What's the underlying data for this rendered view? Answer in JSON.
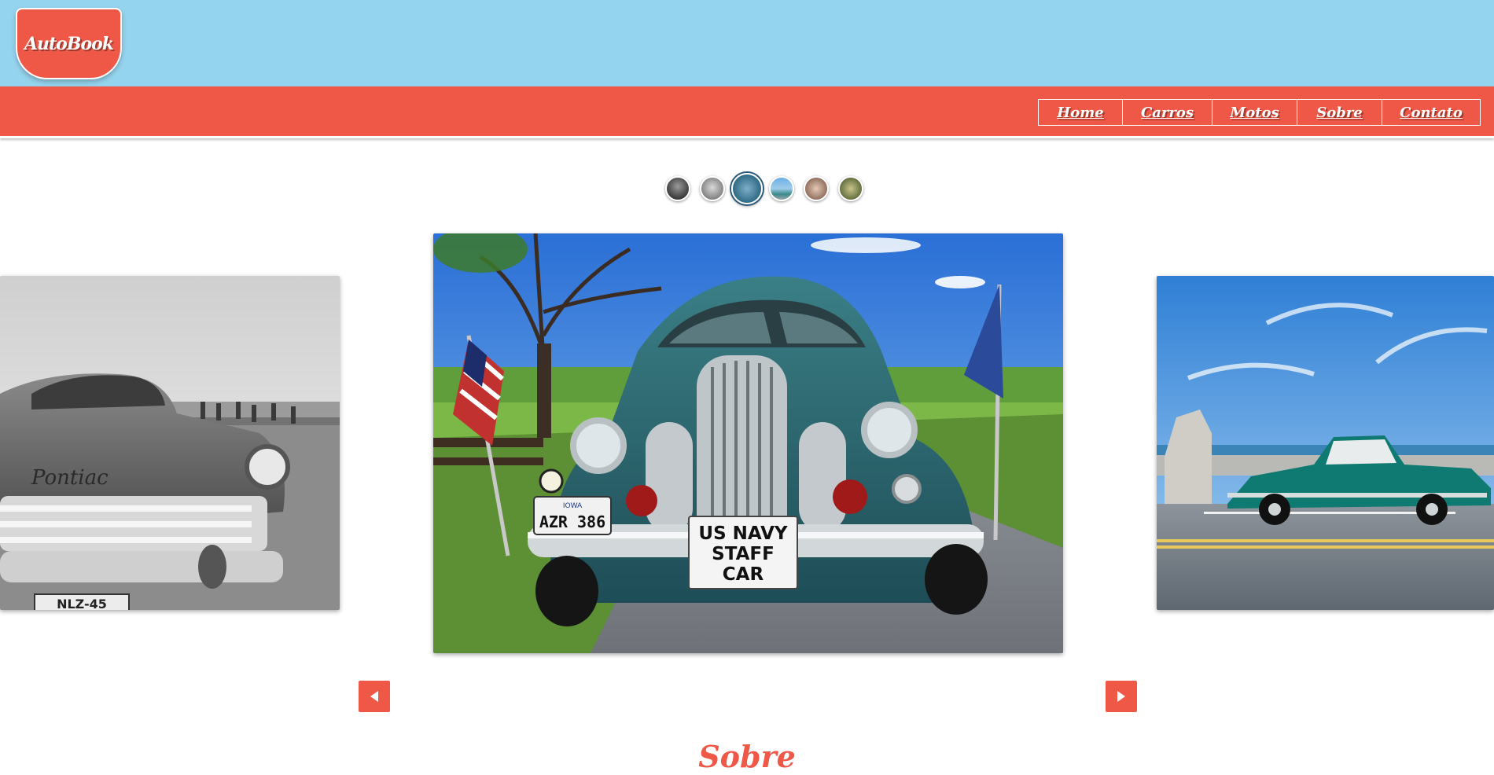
{
  "brand": {
    "logo_text": "AutoBook"
  },
  "nav": {
    "items": [
      {
        "label": "Home"
      },
      {
        "label": "Carros"
      },
      {
        "label": "Motos"
      },
      {
        "label": "Sobre"
      },
      {
        "label": "Contato"
      }
    ]
  },
  "carousel": {
    "active_index": 2,
    "thumbnail_count": 6,
    "slides": [
      {
        "plate": "NLZ-45",
        "badge": "Pontiac"
      },
      {
        "plate": "AZR 386",
        "plate_state": "IOWA",
        "sign_line_1": "US NAVY",
        "sign_line_2": "STAFF",
        "sign_line_3": "CAR"
      },
      {}
    ],
    "prev_icon": "triangle-left-icon",
    "next_icon": "triangle-right-icon"
  },
  "section": {
    "title": "Sobre"
  },
  "colors": {
    "accent": "#ef5847",
    "sky": "#95d4ee",
    "white": "#ffffff"
  }
}
